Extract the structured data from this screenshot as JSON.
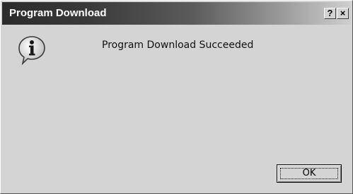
{
  "dialog": {
    "title": "Program Download",
    "help_label": "?",
    "close_label": "×",
    "message": "Program Download Succeeded",
    "icon": "info-icon",
    "ok_label": "OK"
  }
}
